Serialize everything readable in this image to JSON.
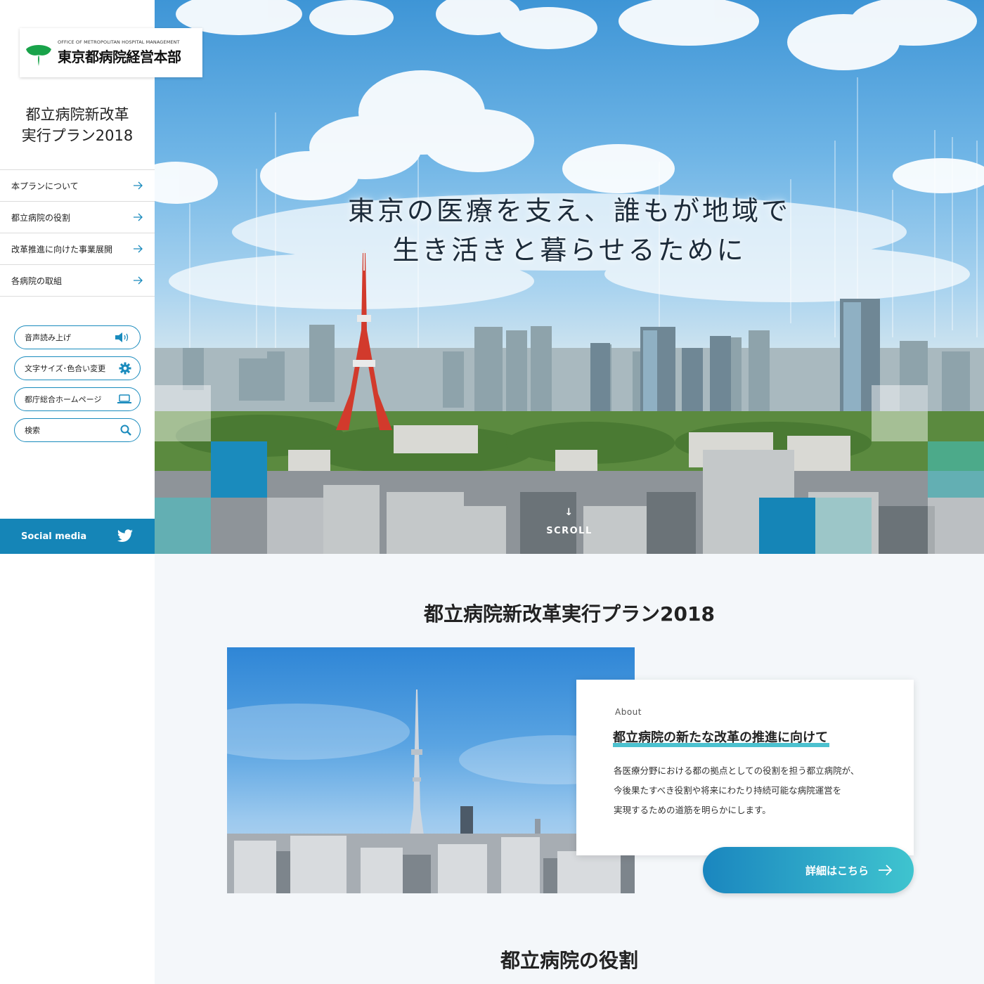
{
  "logo": {
    "en": "OFFICE OF METROPOLITAN HOSPITAL MANAGEMENT",
    "jp": "東京都病院経営本部"
  },
  "site_title": {
    "line1": "都立病院新改革",
    "line2": "実行プラン2018"
  },
  "nav": [
    {
      "label": "本プランについて"
    },
    {
      "label": "都立病院の役割"
    },
    {
      "label": "改革推進に向けた事業展開"
    },
    {
      "label": "各病院の取組"
    }
  ],
  "tools": {
    "voice": "音声読み上げ",
    "text_size": "文字サイズ･色合い変更",
    "homepage": "都庁総合ホームページ",
    "search_placeholder": "検索"
  },
  "social": {
    "label": "Social media"
  },
  "hero": {
    "line1": "東京の医療を支え、誰もが地域で",
    "line2": "生き活きと暮らせるために",
    "scroll": "SCROLL"
  },
  "section": {
    "title": "都立病院新改革実行プラン2018",
    "card": {
      "label": "About",
      "heading": "都立病院の新たな改革の推進に向けて",
      "body": [
        "各医療分野における都の拠点としての役割を担う都立病院が、",
        "今後果たすべき役割や将来にわたり持続可能な病院運営を",
        "実現するための道筋を明らかにします。"
      ]
    },
    "more": "詳細はこちら"
  },
  "section2": {
    "title": "都立病院の役割"
  },
  "colors": {
    "accent": "#1585b7",
    "teal": "#3fc4cf",
    "nav_border": "#dcdcdc"
  }
}
